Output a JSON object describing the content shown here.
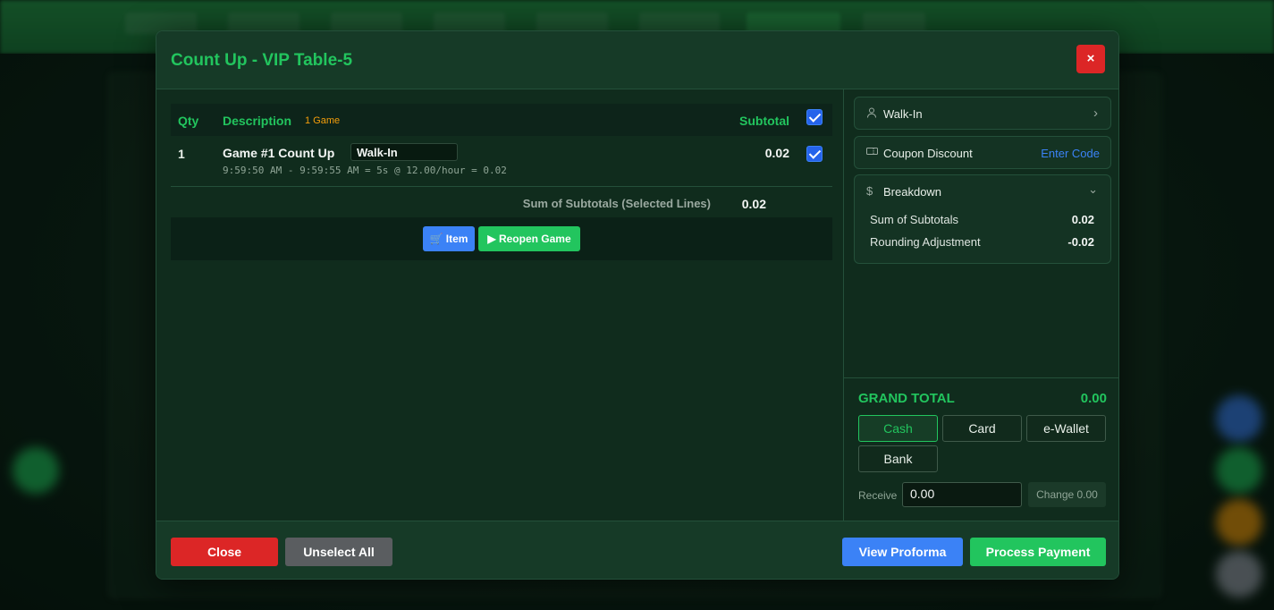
{
  "modal": {
    "title": "Count Up - VIP Table-5",
    "close_icon": "×"
  },
  "table": {
    "headers": {
      "qty": "Qty",
      "description": "Description",
      "subtotal": "Subtotal"
    },
    "game_badge": "1 Game",
    "rows": [
      {
        "qty": "1",
        "description": "Game #1  Count Up",
        "customer_field": "Walk-In",
        "detail": "9:59:50 AM - 9:59:55 AM = 5s @ 12.00/hour = 0.02",
        "subtotal": "0.02",
        "selected": true
      }
    ],
    "sum_label": "Sum of Subtotals (Selected Lines)",
    "sum_value": "0.02"
  },
  "actions": {
    "item_label": "Item",
    "reopen_label": "Reopen Game"
  },
  "sidebar": {
    "customer": "Walk-In",
    "coupon_label": "Coupon Discount",
    "coupon_action": "Enter Code",
    "breakdown_label": "Breakdown",
    "breakdown": [
      {
        "label": "Sum of Subtotals",
        "value": "0.02"
      },
      {
        "label": "Rounding Adjustment",
        "value": "-0.02"
      }
    ],
    "grand_total_label": "GRAND TOTAL",
    "grand_total_value": "0.00",
    "payment_methods": [
      "Cash",
      "Card",
      "e-Wallet",
      "Bank"
    ],
    "selected_payment": "Cash",
    "receive_label": "Receive",
    "receive_value": "0.00",
    "change_text": "Change 0.00"
  },
  "footer": {
    "close_label": "Close",
    "unselect_label": "Unselect All",
    "proforma_label": "View Proforma",
    "process_label": "Process Payment"
  },
  "colors": {
    "accent_green": "#22c55e",
    "danger_red": "#dc2626",
    "primary_blue": "#3b82f6",
    "warning_orange": "#f59e0b"
  }
}
